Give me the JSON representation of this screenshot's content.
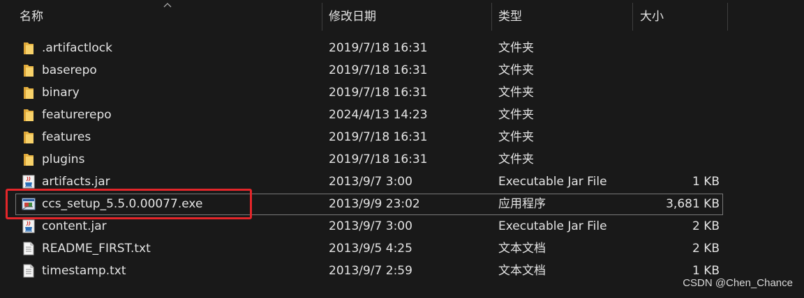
{
  "columns": {
    "name": "名称",
    "date": "修改日期",
    "type": "类型",
    "size": "大小"
  },
  "files": [
    {
      "name": ".artifactlock",
      "date": "2019/7/18 16:31",
      "type": "文件夹",
      "size": "",
      "icon": "folder-icon"
    },
    {
      "name": "baserepo",
      "date": "2019/7/18 16:31",
      "type": "文件夹",
      "size": "",
      "icon": "folder-icon"
    },
    {
      "name": "binary",
      "date": "2019/7/18 16:31",
      "type": "文件夹",
      "size": "",
      "icon": "folder-icon"
    },
    {
      "name": "featurerepo",
      "date": "2024/4/13 14:23",
      "type": "文件夹",
      "size": "",
      "icon": "folder-icon"
    },
    {
      "name": "features",
      "date": "2019/7/18 16:31",
      "type": "文件夹",
      "size": "",
      "icon": "folder-icon"
    },
    {
      "name": "plugins",
      "date": "2019/7/18 16:31",
      "type": "文件夹",
      "size": "",
      "icon": "folder-icon"
    },
    {
      "name": "artifacts.jar",
      "date": "2013/9/7 3:00",
      "type": "Executable Jar File",
      "size": "1 KB",
      "icon": "jar-icon"
    },
    {
      "name": "ccs_setup_5.5.0.00077.exe",
      "date": "2013/9/9 23:02",
      "type": "应用程序",
      "size": "3,681 KB",
      "icon": "exe-icon"
    },
    {
      "name": "content.jar",
      "date": "2013/9/7 3:00",
      "type": "Executable Jar File",
      "size": "2 KB",
      "icon": "jar-icon"
    },
    {
      "name": "README_FIRST.txt",
      "date": "2013/9/5 4:25",
      "type": "文本文档",
      "size": "2 KB",
      "icon": "text-file-icon"
    },
    {
      "name": "timestamp.txt",
      "date": "2013/9/7 2:59",
      "type": "文本文档",
      "size": "1 KB",
      "icon": "text-file-icon"
    }
  ],
  "selected_file": "ccs_setup_5.5.0.00077.exe",
  "highlight_color": "#e3262a",
  "watermark": "CSDN @Chen_Chance"
}
